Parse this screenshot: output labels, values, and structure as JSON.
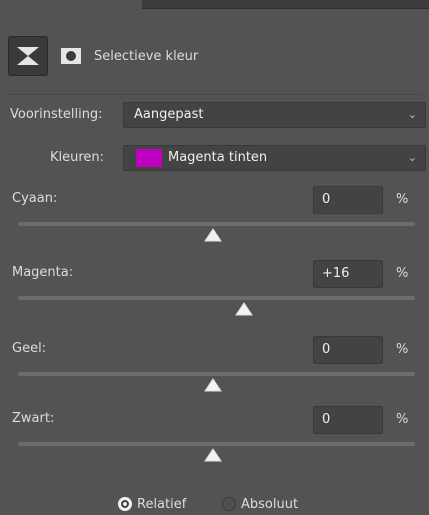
{
  "panel": {
    "title": "Selectieve kleur",
    "icons": [
      "adjustment-layer-icon",
      "layer-mask-icon"
    ]
  },
  "preset": {
    "label": "Voorinstelling:",
    "value": "Aangepast"
  },
  "colors": {
    "label": "Kleuren:",
    "value": "Magenta tinten",
    "swatch": "#c000c0"
  },
  "sliders": [
    {
      "name": "Cyaan:",
      "value": "0",
      "unit": "%",
      "percent": 0
    },
    {
      "name": "Magenta:",
      "value": "+16",
      "unit": "%",
      "percent": 16
    },
    {
      "name": "Geel:",
      "value": "0",
      "unit": "%",
      "percent": 0
    },
    {
      "name": "Zwart:",
      "value": "0",
      "unit": "%",
      "percent": 0
    }
  ],
  "method": {
    "options": [
      "Relatief",
      "Absoluut"
    ],
    "selected": "Relatief"
  },
  "colors_theme": {
    "background": "#535353",
    "field": "#434343",
    "track": "#6c6c6c",
    "text": "#dcdcdc"
  }
}
